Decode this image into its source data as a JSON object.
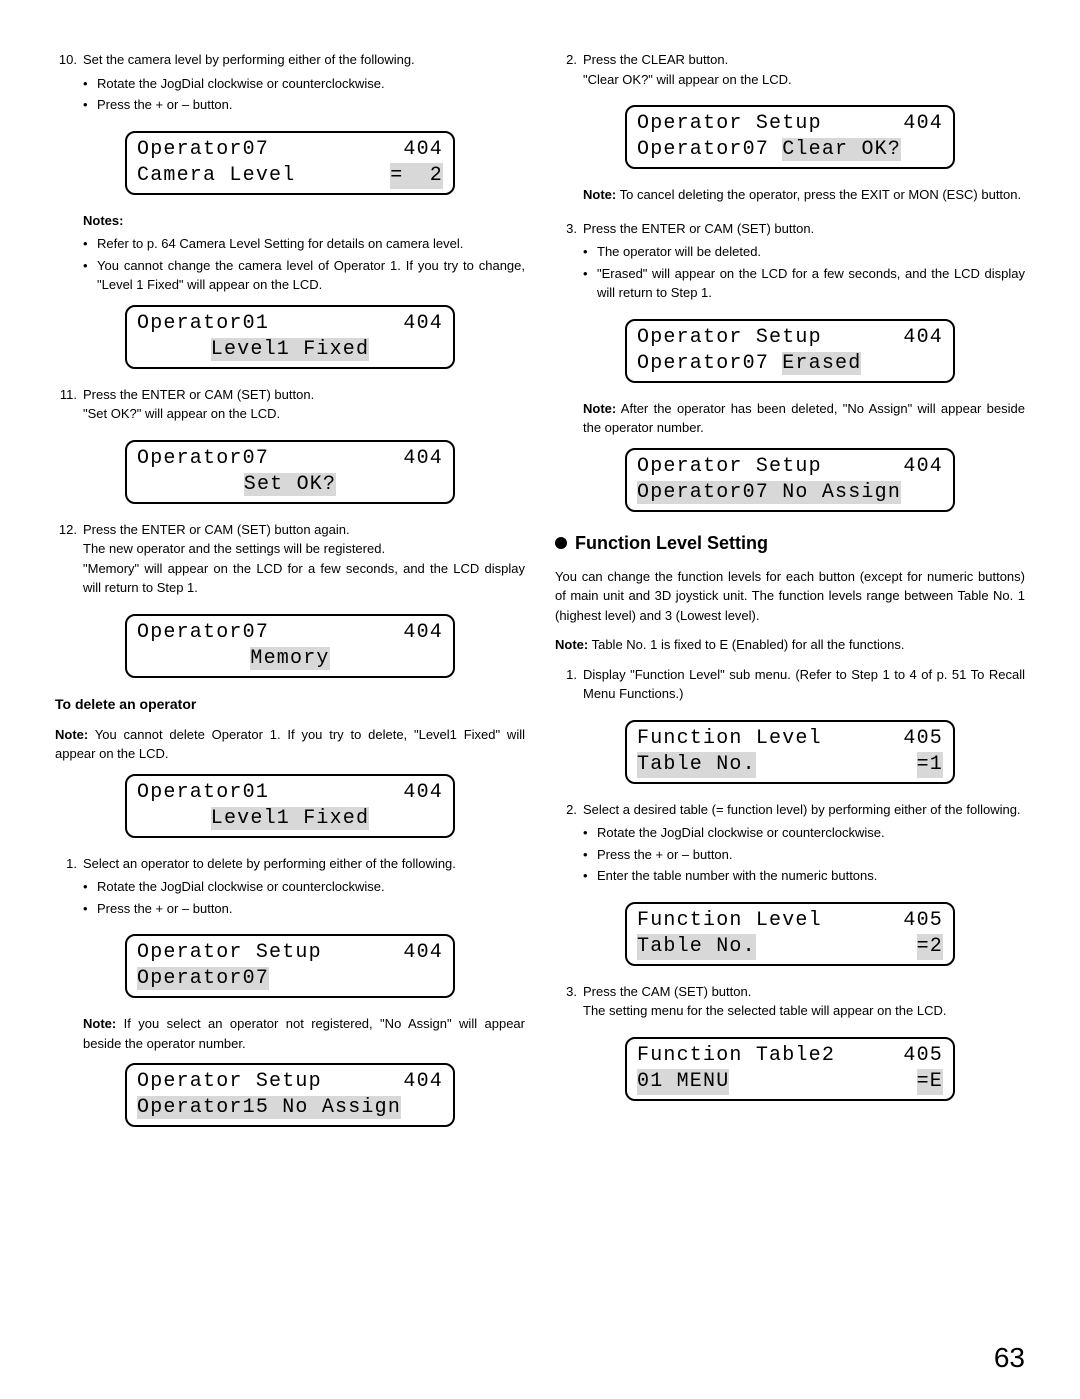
{
  "page_number": "63",
  "left": {
    "step10": {
      "num": "10.",
      "text": "Set the camera level by performing either of the following.",
      "b1": "Rotate the JogDial clockwise or counterclockwise.",
      "b2": "Press the + or – button."
    },
    "lcd1": {
      "l1a": "Operator07",
      "l1b": "404",
      "l2a": "Camera Level",
      "l2b": "=  2"
    },
    "notes_head": "Notes:",
    "note_b1": "Refer to p. 64 Camera Level Setting for details on camera level.",
    "note_b2": "You cannot change the camera level of Operator 1. If you try to change, \"Level 1 Fixed\" will appear on the LCD.",
    "lcd2": {
      "l1a": "Operator01",
      "l1b": "404",
      "l2a": "Level1 Fixed"
    },
    "step11": {
      "num": "11.",
      "t1": "Press the ENTER or CAM (SET) button.",
      "t2": "\"Set OK?\" will appear on the LCD."
    },
    "lcd3": {
      "l1a": "Operator07",
      "l1b": "404",
      "l2a": "Set OK?"
    },
    "step12": {
      "num": "12.",
      "t1": "Press the ENTER or CAM (SET) button again.",
      "t2": "The new operator and the settings will be registered.",
      "t3": "\"Memory\" will appear on the LCD for a few seconds, and the LCD display will return to Step 1."
    },
    "lcd4": {
      "l1a": "Operator07",
      "l1b": "404",
      "l2a": "Memory"
    },
    "del_head": "To delete an operator",
    "del_note_lbl": "Note:",
    "del_note": " You cannot delete Operator 1. If you try to delete, \"Level1 Fixed\" will appear on the LCD.",
    "lcd5": {
      "l1a": "Operator01",
      "l1b": "404",
      "l2a": "Level1 Fixed"
    },
    "dstep1": {
      "num": "1.",
      "text": "Select an operator to delete by performing either of the following.",
      "b1": "Rotate the JogDial clockwise or counterclockwise.",
      "b2": "Press the + or – button."
    },
    "lcd6": {
      "l1a": "Operator Setup",
      "l1b": "404",
      "l2a": "Operator07"
    },
    "dnote1_lbl": "Note:",
    "dnote1": " If you select an operator not registered, \"No Assign\" will appear beside the operator number.",
    "lcd7": {
      "l1a": "Operator Setup",
      "l1b": "404",
      "l2a": "Operator15 No Assign"
    }
  },
  "right": {
    "rstep2": {
      "num": "2.",
      "t1": "Press the CLEAR button.",
      "t2": "\"Clear OK?\" will appear on the LCD."
    },
    "lcd8": {
      "l1a": "Operator Setup",
      "l1b": "404",
      "l2a": "Operator07 ",
      "l2b": "Clear OK?"
    },
    "rnote2_lbl": "Note:",
    "rnote2": " To cancel deleting the operator, press the EXIT or MON (ESC) button.",
    "rstep3": {
      "num": "3.",
      "text": "Press the ENTER or CAM (SET) button.",
      "b1": "The operator will be deleted.",
      "b2": "\"Erased\" will appear on the LCD for a few seconds, and the LCD display will return to Step 1."
    },
    "lcd9": {
      "l1a": "Operator Setup",
      "l1b": "404",
      "l2a": "Operator07 ",
      "l2b": "Erased"
    },
    "rnote3_lbl": "Note:",
    "rnote3": " After the operator has been deleted, \"No Assign\" will appear beside the operator number.",
    "lcd10": {
      "l1a": "Operator Setup",
      "l1b": "404",
      "l2a": "Operator07 No Assign"
    },
    "fls_head": "Function Level Setting",
    "fls_para": "You can change the function levels for each button (except for numeric buttons) of main unit and 3D joystick unit. The function levels range between Table No. 1 (highest level) and 3 (Lowest level).",
    "fls_note_lbl": "Note:",
    "fls_note": " Table No. 1 is fixed to E (Enabled) for all the functions.",
    "fstep1": {
      "num": "1.",
      "text": "Display \"Function Level\" sub menu. (Refer to Step 1 to 4 of p. 51 To Recall Menu Functions.)"
    },
    "lcd11": {
      "l1a": "Function Level",
      "l1b": "405",
      "l2a": "Table No.",
      "l2b": "=1"
    },
    "fstep2": {
      "num": "2.",
      "text": "Select a desired table (= function level)  by performing either of the following.",
      "b1": "Rotate the JogDial clockwise or counterclockwise.",
      "b2": "Press the + or – button.",
      "b3": "Enter the table number with the numeric buttons."
    },
    "lcd12": {
      "l1a": "Function Level",
      "l1b": "405",
      "l2a": "Table No.",
      "l2b": "=2"
    },
    "fstep3": {
      "num": "3.",
      "t1": "Press the CAM (SET) button.",
      "t2": "The setting menu for the selected table will appear on the LCD."
    },
    "lcd13": {
      "l1a": "Function Table2",
      "l1b": "405",
      "l2a": "01 MENU",
      "l2b": "=E"
    }
  }
}
